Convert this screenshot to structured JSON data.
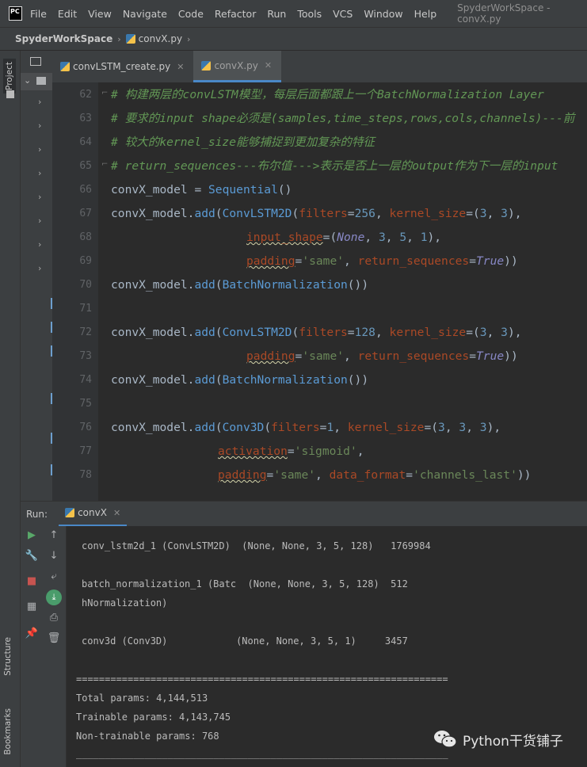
{
  "menubar": {
    "logo": "PC",
    "items": [
      "File",
      "Edit",
      "View",
      "Navigate",
      "Code",
      "Refactor",
      "Run",
      "Tools",
      "VCS",
      "Window",
      "Help"
    ],
    "window_title": "SpyderWorkSpace - convX.py"
  },
  "breadcrumb": {
    "project": "SpyderWorkSpace",
    "file": "convX.py"
  },
  "left_strip": {
    "project_tab": "Project",
    "structure_tab": "Structure",
    "bookmarks_tab": "Bookmarks"
  },
  "editor_tabs": [
    {
      "label": "convLSTM_create.py",
      "active": false
    },
    {
      "label": "convX.py",
      "active": true
    }
  ],
  "editor": {
    "line_numbers": [
      "62",
      "63",
      "64",
      "65",
      "66",
      "67",
      "68",
      "69",
      "70",
      "71",
      "72",
      "73",
      "74",
      "75",
      "76",
      "77",
      "78"
    ],
    "comments": {
      "c62": "# 构建两层的convLSTM模型，每层后面都跟上一个BatchNormalization Layer",
      "c63": "# 要求的input shape必须是(samples,time_steps,rows,cols,channels)---前",
      "c64": "# 较大的kernel_size能够捕捉到更加复杂的特征",
      "c65": "# return_sequences---布尔值--->表示是否上一层的output作为下一层的input"
    },
    "tokens": {
      "model": "convX_model",
      "sequential": "Sequential",
      "add": "add",
      "convlstm2d": "ConvLSTM2D",
      "batchnorm": "BatchNormalization",
      "conv3d": "Conv3D",
      "filters": "filters",
      "kernel_size": "kernel_size",
      "input_shape": "input_shape",
      "padding": "padding",
      "return_sequences": "return_sequences",
      "activation": "activation",
      "data_format": "data_format",
      "none": "None",
      "true": "True",
      "same": "'same'",
      "sigmoid": "'sigmoid'",
      "channels_last": "'channels_last'",
      "f256": "256",
      "f128": "128",
      "f1": "1",
      "n3": "3",
      "n5": "5",
      "n1": "1"
    }
  },
  "run": {
    "label": "Run:",
    "tab": "convX",
    "output": [
      "conv_lstm2d_1 (ConvLSTM2D)  (None, None, 3, 5, 128)   1769984",
      "batch_normalization_1 (Batc  (None, None, 3, 5, 128)  512",
      "hNormalization)",
      "conv3d (Conv3D)            (None, None, 3, 5, 1)     3457",
      "=================================================================",
      "Total params: 4,144,513",
      "Trainable params: 4,143,745",
      "Non-trainable params: 768",
      "_________________________________________________________________"
    ]
  },
  "watermark": {
    "text": "Python干货铺子"
  },
  "colors": {
    "background": "#2b2b2b",
    "chrome": "#3c3f41",
    "accent": "#4a88c7",
    "comment": "#629755",
    "keyword": "#cc7832",
    "string": "#6a8759",
    "number": "#6897bb"
  }
}
